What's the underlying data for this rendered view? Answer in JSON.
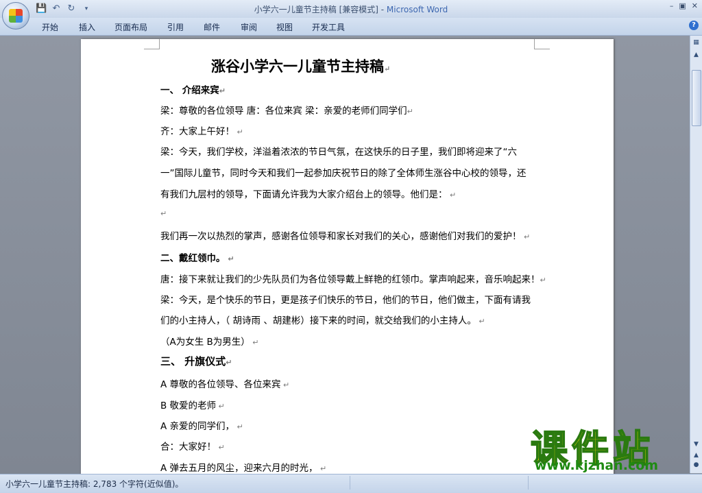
{
  "window": {
    "title_doc": "小学六一儿童节主持稿 [兼容模式] - ",
    "title_app": "Microsoft Word"
  },
  "ribbon": {
    "tabs": [
      "开始",
      "插入",
      "页面布局",
      "引用",
      "邮件",
      "审阅",
      "视图",
      "开发工具"
    ]
  },
  "document": {
    "title": "涨谷小学六一儿童节主持稿",
    "lines": [
      "一、      介绍来宾",
      "梁：尊敬的各位领导    唐：各位来宾      梁：亲爱的老师们同学们",
      "齐：大家上午好！",
      "梁：今天，我们学校，洋溢着浓浓的节日气氛，在这快乐的日子里，我们即将迎来了“六",
      "一”国际儿童节，同时今天和我们一起参加庆祝节日的除了全体师生涨谷中心校的领导，还",
      "有我们九层村的领导，下面请允许我为大家介绍台上的领导。他们是：",
      "",
      "我们再一次以热烈的掌声，感谢各位领导和家长对我们的关心，感谢他们对我们的爱护！",
      "二、戴红领巾。",
      "唐：接下来就让我们的少先队员们为各位领导戴上鲜艳的红领巾。掌声响起来，音乐响起来！",
      "梁：今天，是个快乐的节日，更是孩子们快乐的节日，他们的节日，他们做主，下面有请我",
      "们的小主持人，（ 胡诗雨 、胡建彬）接下来的时间，就交给我们的小主持人。",
      "（A为女生 B为男生）",
      "三、   升旗仪式",
      "  A 尊敬的各位领导、各位来宾",
      "  B 敬爱的老师",
      "  A 亲爱的同学们，",
      "  合：大家好！",
      " A    弹去五月的风尘，迎来六月的时光，"
    ]
  },
  "status": {
    "text": "小学六一儿童节主持稿: 2,783 个字符(近似值)。"
  },
  "watermark": {
    "big": "课件站",
    "url": "www.kjzhan.com"
  }
}
